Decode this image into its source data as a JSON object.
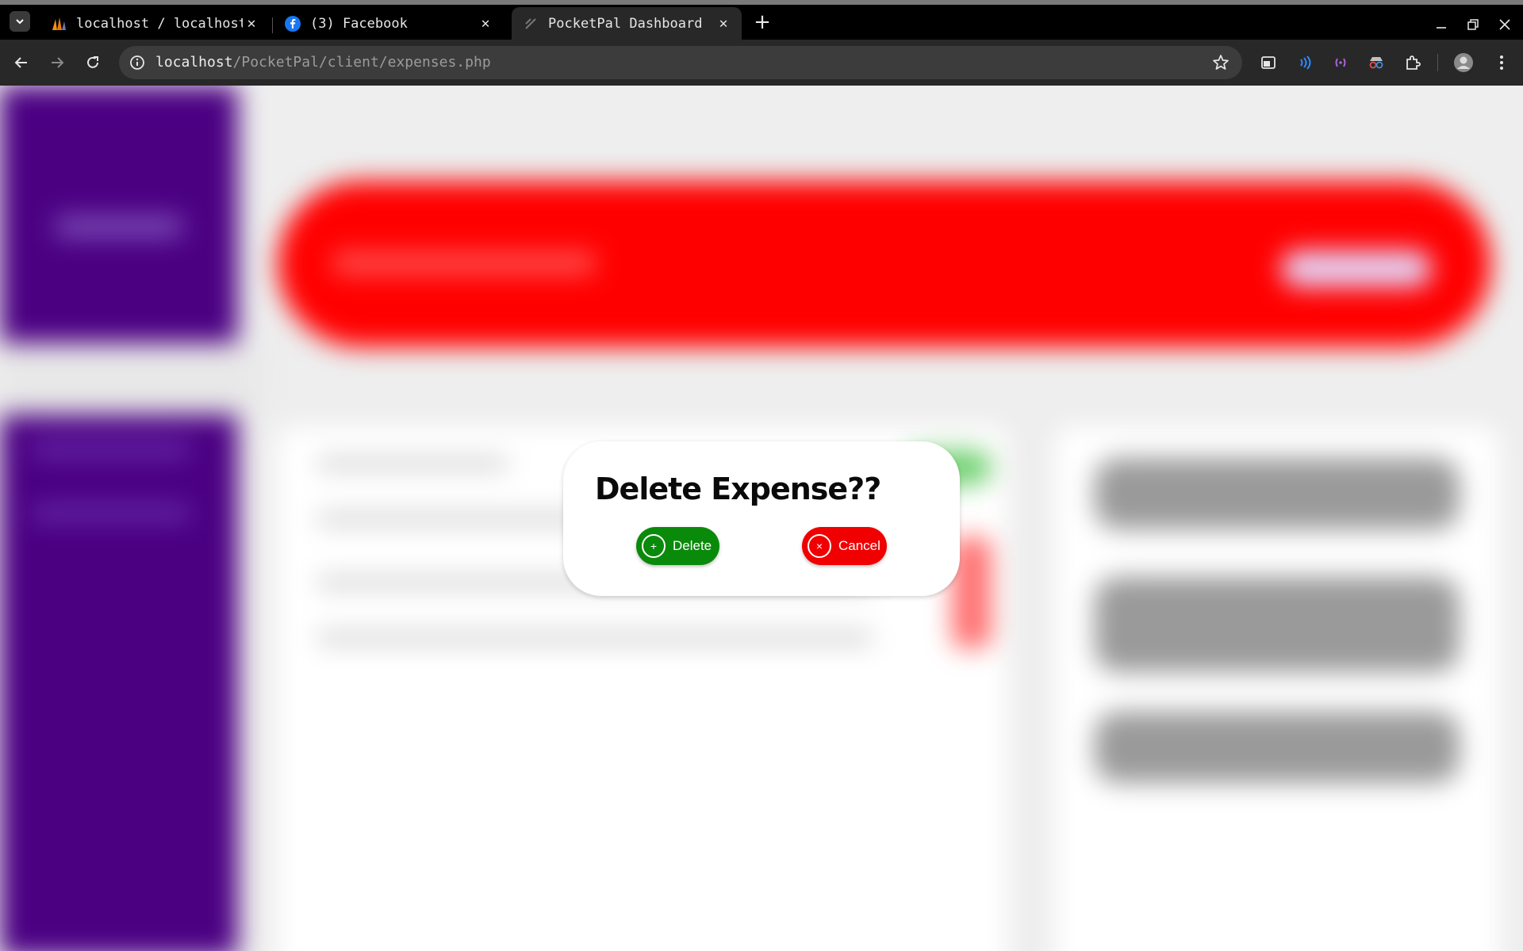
{
  "browser": {
    "tabs": [
      {
        "title": "localhost / localhost",
        "favicon": "phpmyadmin-icon",
        "active": false
      },
      {
        "title": "(3) Facebook",
        "favicon": "facebook-icon",
        "active": false
      },
      {
        "title": "PocketPal Dashboard",
        "favicon": "page-icon",
        "active": true
      }
    ],
    "url_host": "localhost",
    "url_path": "/PocketPal/client/expenses.php",
    "colors": {
      "chrome_bg": "#000000",
      "toolbar_bg": "#282828",
      "omnibox_bg": "#3c3c3c"
    }
  },
  "page": {
    "colors": {
      "sidebar": "#4b0082",
      "banner": "#ff0000",
      "delete_button": "#0a8a0a",
      "cancel_button": "#f00000"
    }
  },
  "modal": {
    "title": "Delete Expense??",
    "delete_icon": "+",
    "delete_label": "Delete",
    "cancel_icon": "×",
    "cancel_label": "Cancel"
  }
}
